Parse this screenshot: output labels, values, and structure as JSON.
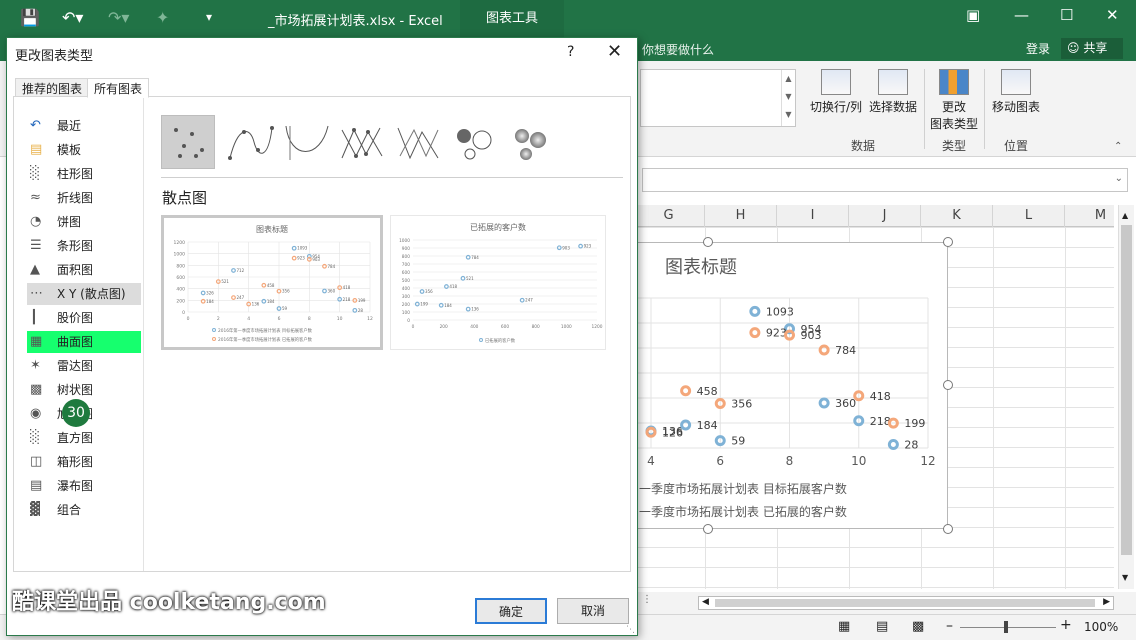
{
  "excel": {
    "doc_title": "_市场拓展计划表.xlsx - Excel",
    "ctx_tab": "图表工具",
    "tell_me": "你想要做什么",
    "login": "登录",
    "share": "共享"
  },
  "ribbon": {
    "switch_rowcol": "切换行/列",
    "select_data": "选择数据",
    "change_type_l1": "更改",
    "change_type_l2": "图表类型",
    "move_chart": "移动图表",
    "group_data": "数据",
    "group_type": "类型",
    "group_location": "位置"
  },
  "grid": {
    "columns": [
      "G",
      "H",
      "I",
      "J",
      "K",
      "L",
      "M"
    ]
  },
  "status": {
    "zoom": "100%"
  },
  "dialog": {
    "title": "更改图表类型",
    "help": "?",
    "tabs": [
      "推荐的图表",
      "所有图表"
    ],
    "types": [
      {
        "label": "最近",
        "icon": "recent-icon"
      },
      {
        "label": "模板",
        "icon": "folder-icon"
      },
      {
        "label": "柱形图",
        "icon": "column-chart-icon"
      },
      {
        "label": "折线图",
        "icon": "line-chart-icon"
      },
      {
        "label": "饼图",
        "icon": "pie-chart-icon"
      },
      {
        "label": "条形图",
        "icon": "bar-chart-icon"
      },
      {
        "label": "面积图",
        "icon": "area-chart-icon"
      },
      {
        "label": "X Y (散点图)",
        "icon": "scatter-chart-icon"
      },
      {
        "label": "股价图",
        "icon": "stock-chart-icon"
      },
      {
        "label": "曲面图",
        "icon": "surface-chart-icon"
      },
      {
        "label": "雷达图",
        "icon": "radar-chart-icon"
      },
      {
        "label": "树状图",
        "icon": "treemap-icon"
      },
      {
        "label": "旭日图",
        "icon": "sunburst-icon"
      },
      {
        "label": "直方图",
        "icon": "histogram-icon"
      },
      {
        "label": "箱形图",
        "icon": "boxplot-icon"
      },
      {
        "label": "瀑布图",
        "icon": "waterfall-icon"
      },
      {
        "label": "组合",
        "icon": "combo-chart-icon"
      }
    ],
    "badge": "30",
    "subtype_title": "散点图",
    "ok": "确定",
    "cancel": "取消",
    "preview1": {
      "title": "图表标题",
      "yticks": [
        "0",
        "200",
        "400",
        "600",
        "800",
        "1000",
        "1200"
      ],
      "xticks": [
        "0",
        "2",
        "4",
        "6",
        "8",
        "10",
        "12"
      ],
      "legend1": "2016年第一季度市场拓展计划表 目标拓展客户数",
      "legend2": "2016年第一季度市场拓展计划表 已拓展的客户数"
    },
    "preview2": {
      "title": "已拓展的客户数",
      "yticks": [
        "0",
        "100",
        "200",
        "300",
        "400",
        "500",
        "600",
        "700",
        "800",
        "900",
        "1000"
      ],
      "xticks": [
        "0",
        "200",
        "400",
        "600",
        "800",
        "1000",
        "1200"
      ],
      "legend": "已拓展的客户数"
    }
  },
  "chart_data": [
    {
      "type": "scatter",
      "title": "图表标题",
      "xlim": [
        0,
        12
      ],
      "ylim": [
        0,
        1200
      ],
      "xticks": [
        "0",
        "2",
        "4",
        "6",
        "8",
        "10",
        "12"
      ],
      "yticks": [
        "0",
        "200",
        "400",
        "600",
        "800",
        "1000",
        "1200"
      ],
      "series": [
        {
          "name": "2016年第一季度市场拓展计划表 目标拓展客户数",
          "color": "#7fb2d6",
          "points": [
            {
              "x": 1,
              "y": 326
            },
            {
              "x": 3,
              "y": 712
            },
            {
              "x": 5,
              "y": 184
            },
            {
              "x": 6,
              "y": 59
            },
            {
              "x": 7,
              "y": 1093
            },
            {
              "x": 8,
              "y": 954
            },
            {
              "x": 9,
              "y": 360
            },
            {
              "x": 10,
              "y": 218
            },
            {
              "x": 11,
              "y": 28
            }
          ]
        },
        {
          "name": "2016年第一季度市场拓展计划表 已拓展的客户数",
          "color": "#f4a77a",
          "points": [
            {
              "x": 1,
              "y": 184
            },
            {
              "x": 2,
              "y": 521
            },
            {
              "x": 3,
              "y": 247
            },
            {
              "x": 4,
              "y": 136
            },
            {
              "x": 5,
              "y": 458
            },
            {
              "x": 6,
              "y": 356
            },
            {
              "x": 7,
              "y": 923
            },
            {
              "x": 8,
              "y": 903
            },
            {
              "x": 9,
              "y": 784
            },
            {
              "x": 10,
              "y": 418
            },
            {
              "x": 11,
              "y": 199
            }
          ]
        }
      ]
    },
    {
      "type": "scatter",
      "title": "已拓展的客户数",
      "xlim": [
        0,
        1200
      ],
      "ylim": [
        0,
        1000
      ],
      "series": [
        {
          "name": "已拓展的客户数",
          "color": "#7fb2d6",
          "points": [
            {
              "x": 28,
              "y": 199
            },
            {
              "x": 59,
              "y": 356
            },
            {
              "x": 184,
              "y": 184
            },
            {
              "x": 326,
              "y": 521
            },
            {
              "x": 218,
              "y": 418
            },
            {
              "x": 360,
              "y": 136
            },
            {
              "x": 712,
              "y": 247
            },
            {
              "x": 954,
              "y": 903
            },
            {
              "x": 1093,
              "y": 923
            },
            {
              "x": 360,
              "y": 784
            }
          ]
        }
      ]
    },
    {
      "type": "scatter",
      "title": "图表标题",
      "xlim": [
        0,
        12
      ],
      "ylim": [
        0,
        1200
      ],
      "xticks": [
        "4",
        "6",
        "8",
        "10",
        "12"
      ],
      "legend1": "一季度市场拓展计划表 目标拓展客户数",
      "legend2": "一季度市场拓展计划表 已拓展的客户数",
      "series": [
        {
          "name": "目标拓展客户数",
          "color": "#7fb2d6",
          "points": [
            {
              "x": 4,
              "y": 136
            },
            {
              "x": 5,
              "y": 184
            },
            {
              "x": 6,
              "y": 59
            },
            {
              "x": 7,
              "y": 1093
            },
            {
              "x": 8,
              "y": 954
            },
            {
              "x": 9,
              "y": 360
            },
            {
              "x": 10,
              "y": 218
            },
            {
              "x": 11,
              "y": 28
            }
          ]
        },
        {
          "name": "已拓展的客户数",
          "color": "#f4a77a",
          "points": [
            {
              "x": 4,
              "y": 126
            },
            {
              "x": 5,
              "y": 458
            },
            {
              "x": 6,
              "y": 356
            },
            {
              "x": 7,
              "y": 923
            },
            {
              "x": 8,
              "y": 903
            },
            {
              "x": 9,
              "y": 784
            },
            {
              "x": 10,
              "y": 418
            },
            {
              "x": 11,
              "y": 199
            }
          ]
        }
      ]
    }
  ],
  "watermark": "酷课堂出品 coolketang.com"
}
